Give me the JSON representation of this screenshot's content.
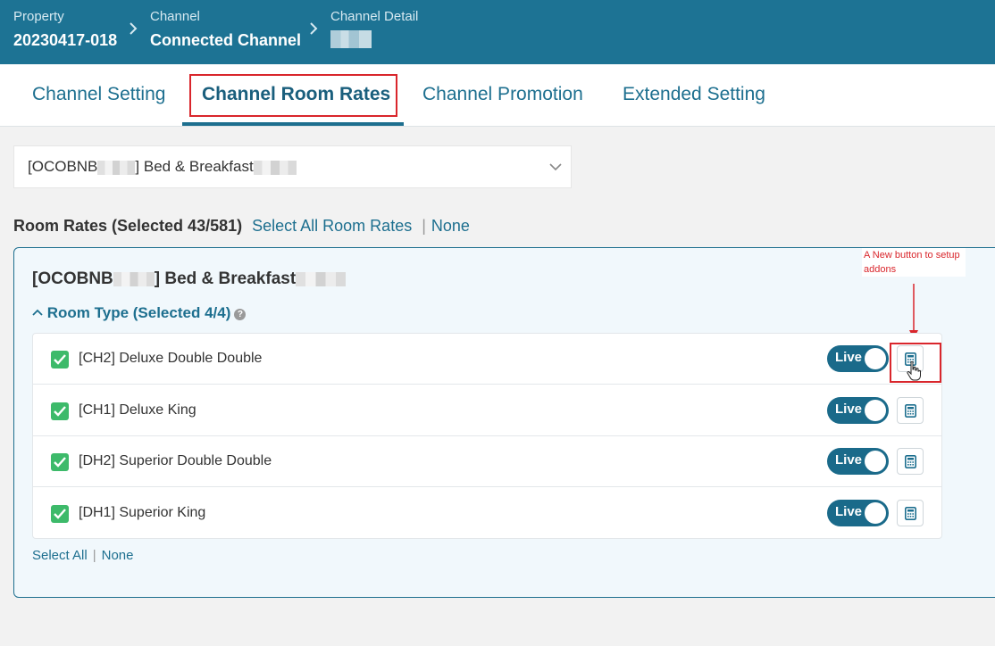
{
  "header": {
    "breadcrumbs": [
      {
        "label": "Property",
        "value": "20230417-018"
      },
      {
        "label": "Channel",
        "value": "Connected Channel"
      },
      {
        "label": "Channel Detail",
        "value": ""
      }
    ]
  },
  "tabs": [
    {
      "label": "Channel Setting",
      "active": false
    },
    {
      "label": "Channel Room Rates",
      "active": true
    },
    {
      "label": "Channel Promotion",
      "active": false
    },
    {
      "label": "Extended Setting",
      "active": false
    }
  ],
  "rate_plan_select": {
    "prefix": "[OCOBNB",
    "middle": "] Bed & Breakfast"
  },
  "room_rates": {
    "title": "Room Rates (Selected 43/581)",
    "select_all": "Select All Room Rates",
    "none": "None"
  },
  "panel": {
    "title_prefix": "[OCOBNB",
    "title_middle": "] Bed & Breakfast",
    "room_type_header": "Room Type (Selected 4/4)",
    "help_glyph": "?",
    "rows": [
      {
        "label": "[CH2] Deluxe Double Double",
        "status": "Live",
        "checked": true
      },
      {
        "label": "[CH1] Deluxe King",
        "status": "Live",
        "checked": true
      },
      {
        "label": "[DH2] Superior Double Double",
        "status": "Live",
        "checked": true
      },
      {
        "label": "[DH1] Superior King",
        "status": "Live",
        "checked": true
      }
    ],
    "select_all": "Select All",
    "none": "None"
  },
  "annotation": {
    "text": "A New button to setup addons",
    "color": "#d9262c"
  },
  "colors": {
    "header_bg": "#1d7394",
    "accent": "#1d6f8f",
    "check_green": "#3dba6a",
    "toggle_bg": "#1a6a8a"
  }
}
